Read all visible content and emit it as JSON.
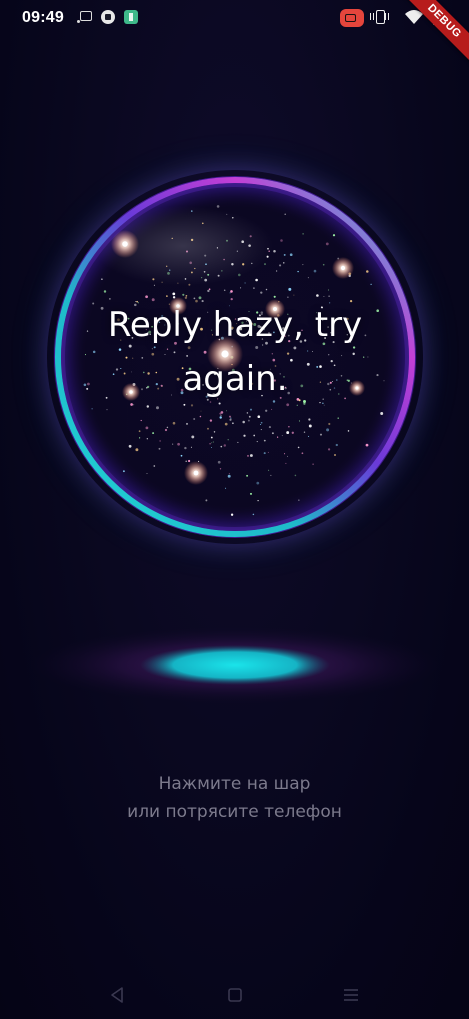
{
  "status_bar": {
    "time": "09:49"
  },
  "debug_banner": {
    "label": "DEBUG"
  },
  "ball": {
    "answer": "Reply hazy, try again."
  },
  "hint": {
    "line1": "Нажмите на шар",
    "line2": "или потрясите телефон"
  },
  "nav": {
    "back_icon": "triangle-back",
    "home_icon": "square-home",
    "recents_icon": "lines-menu"
  },
  "colors": {
    "background": "#0a0820",
    "rim_cyan": "#22d6d8",
    "rim_magenta": "#c040d8",
    "pedestal_cyan": "#19d9e0",
    "hint_text": "#7c7a8c",
    "debug_red": "#b71c1c",
    "record_red": "#e5453c"
  }
}
